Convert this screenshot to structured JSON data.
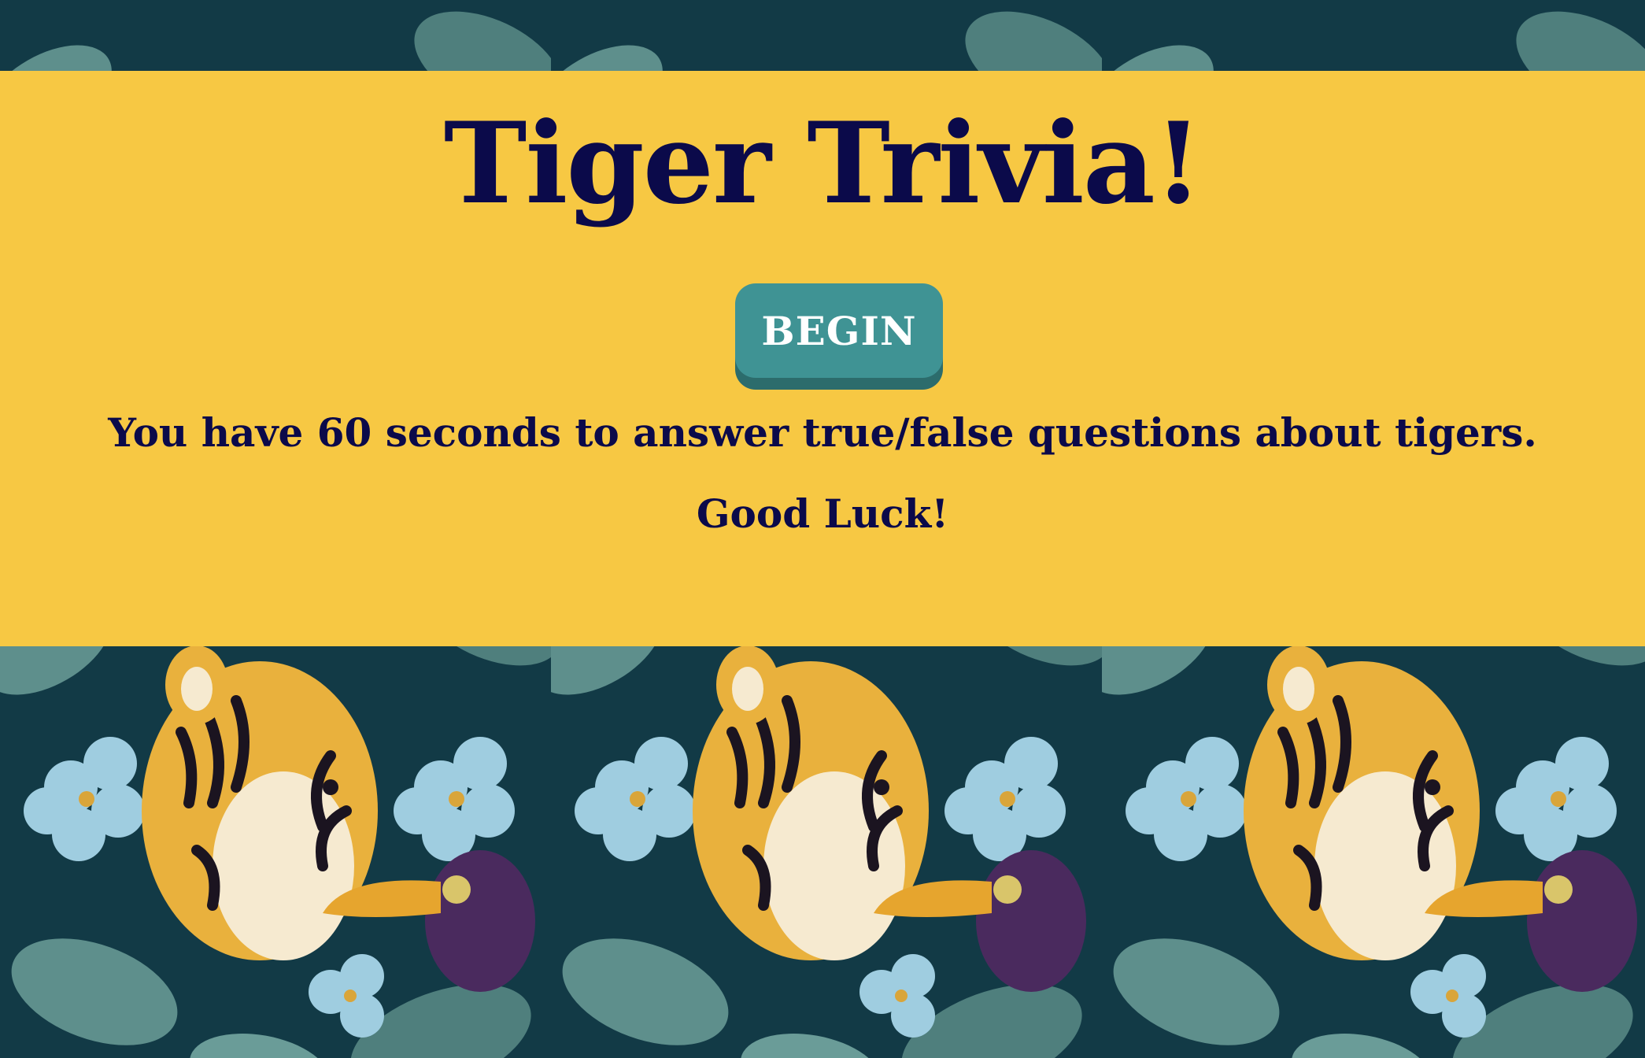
{
  "page": {
    "title": "Tiger Trivia!",
    "begin_label": "BEGIN",
    "instructions": "You have 60 seconds to answer true/false questions about tigers.",
    "good_luck": "Good Luck!"
  },
  "colors": {
    "panel": "#f7c843",
    "text": "#0b0a4a",
    "button": "#3f9394",
    "button_shadow": "#2c6c6c",
    "jungle_dark": "#123a46",
    "leaf": "#5e8f8c",
    "flower": "#9fcde0",
    "tiger": "#e9b13d",
    "toucan": "#4a2a5e"
  }
}
